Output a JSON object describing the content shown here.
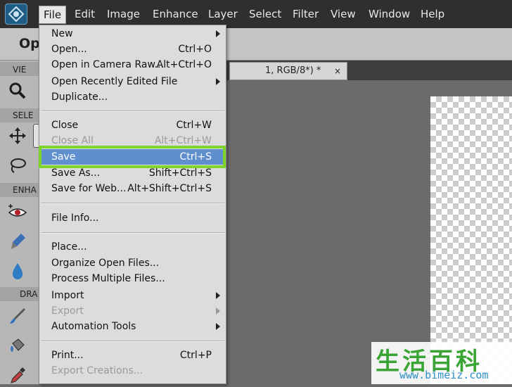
{
  "menubar": {
    "items": [
      "File",
      "Edit",
      "Image",
      "Enhance",
      "Layer",
      "Select",
      "Filter",
      "View",
      "Window",
      "Help"
    ]
  },
  "subbar": {
    "title": "Op"
  },
  "toolpanel": {
    "sections": [
      "VIE",
      "SELE",
      "ENHA",
      "DRA"
    ]
  },
  "document_tab": {
    "label": "1, RGB/8*) *",
    "close": "×"
  },
  "file_menu": {
    "items": [
      {
        "label": "New",
        "shortcut": ""
      },
      {
        "label": "Open...",
        "shortcut": "Ctrl+O"
      },
      {
        "label": "Open in Camera Raw...",
        "shortcut": "Alt+Ctrl+O"
      },
      {
        "label": "Open Recently Edited File",
        "shortcut": ""
      },
      {
        "label": "Duplicate...",
        "shortcut": ""
      },
      {
        "label": "Close",
        "shortcut": "Ctrl+W"
      },
      {
        "label": "Close All",
        "shortcut": "Alt+Ctrl+W"
      },
      {
        "label": "Save",
        "shortcut": "Ctrl+S"
      },
      {
        "label": "Save As...",
        "shortcut": "Shift+Ctrl+S"
      },
      {
        "label": "Save for Web...",
        "shortcut": "Alt+Shift+Ctrl+S"
      },
      {
        "label": "File Info...",
        "shortcut": ""
      },
      {
        "label": "Place...",
        "shortcut": ""
      },
      {
        "label": "Organize Open Files...",
        "shortcut": ""
      },
      {
        "label": "Process Multiple Files...",
        "shortcut": ""
      },
      {
        "label": "Import",
        "shortcut": ""
      },
      {
        "label": "Export",
        "shortcut": ""
      },
      {
        "label": "Automation Tools",
        "shortcut": ""
      },
      {
        "label": "Print...",
        "shortcut": "Ctrl+P"
      },
      {
        "label": "Export Creations...",
        "shortcut": ""
      }
    ]
  },
  "watermark": {
    "cn": "生活百科",
    "url": "www.bimeiz.com"
  },
  "colors": {
    "highlight": "#5f8fcf",
    "callout": "#7fd62a",
    "menubar": "#2f2f2f"
  }
}
